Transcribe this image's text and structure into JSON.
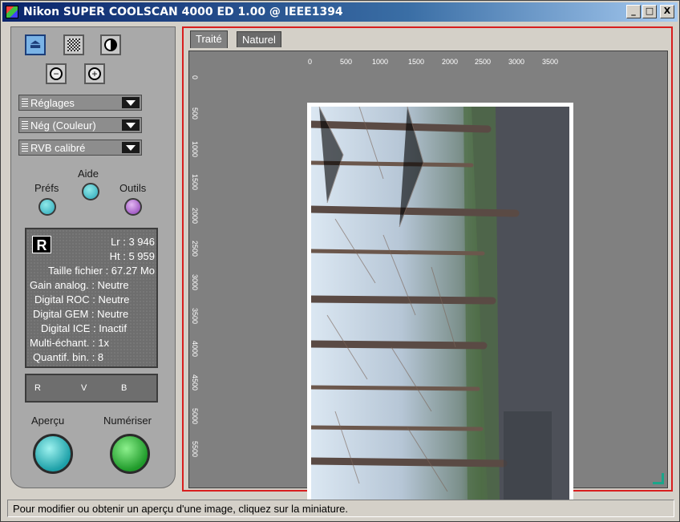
{
  "window": {
    "title": "Nikon SUPER COOLSCAN 4000 ED 1.00 @ IEEE1394",
    "buttons": {
      "minimize": "_",
      "maximize": "□",
      "close": "X"
    }
  },
  "sidebar": {
    "tools": [
      {
        "name": "eject-icon"
      },
      {
        "name": "grid-pattern-icon"
      },
      {
        "name": "contrast-icon"
      },
      {
        "name": "zoom-out-icon"
      },
      {
        "name": "zoom-in-icon"
      }
    ],
    "dropdowns": [
      {
        "value": "Réglages"
      },
      {
        "value": "Nég (Couleur)"
      },
      {
        "value": "RVB calibré"
      }
    ],
    "labels": {
      "aide": "Aide",
      "prefs": "Préfs",
      "outils": "Outils"
    },
    "info": {
      "badge": "R",
      "rows": [
        "Lr : 3 946",
        "Ht : 5 959",
        "Taille fichier : 67.27 Mo",
        "Gain analog. : Neutre",
        "Digital ROC : Neutre",
        "Digital GEM : Neutre",
        "Digital ICE : Inactif",
        "Multi-échant. : 1x",
        "Quantif. bin. : 8"
      ]
    },
    "rvb": {
      "r": "R",
      "v": "V",
      "b": "B"
    },
    "actions": {
      "preview": "Aperçu",
      "scan": "Numériser"
    }
  },
  "view": {
    "tabs": [
      "Traité",
      "Naturel"
    ],
    "hruler": [
      "0",
      "500",
      "1000",
      "1500",
      "2000",
      "2500",
      "3000",
      "3500"
    ],
    "vruler": [
      "0",
      "500",
      "1000",
      "1500",
      "2000",
      "2500",
      "3000",
      "3500",
      "4000",
      "4500",
      "5000",
      "5500"
    ]
  },
  "status": {
    "text": "Pour modifier ou obtenir un aperçu d'une image, cliquez sur la miniature."
  },
  "colors": {
    "frame": "#d81e1e",
    "title_start": "#0a246a",
    "panel": "#a9a9a9"
  }
}
